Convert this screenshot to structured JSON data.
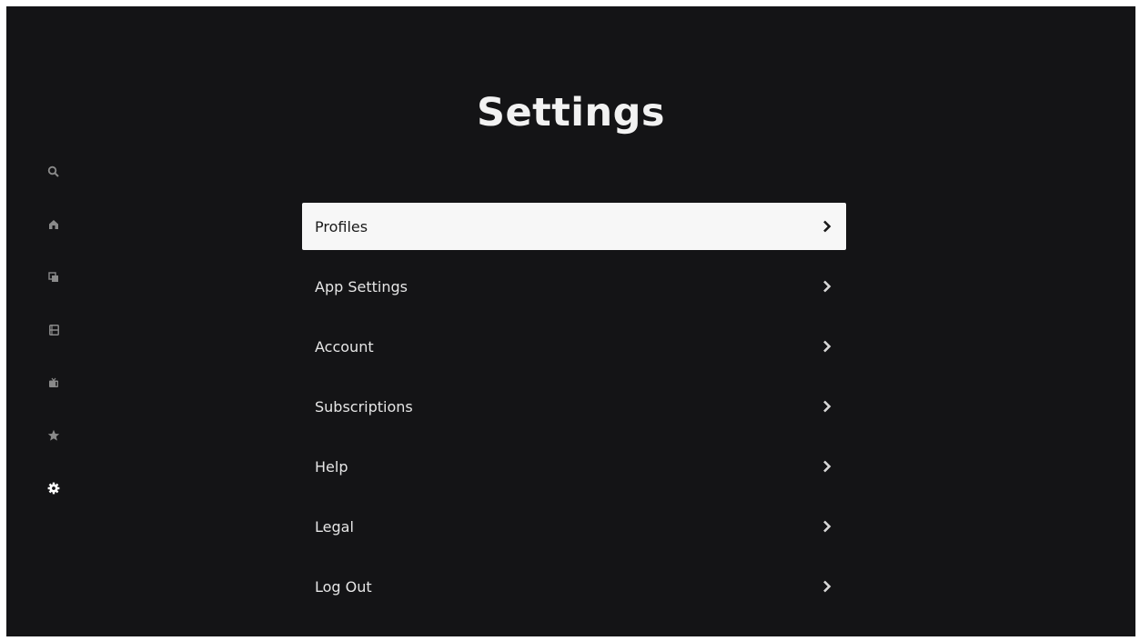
{
  "page": {
    "title": "Settings",
    "background": "#141416",
    "accent_selected": "#f7f7f7"
  },
  "sidebar": {
    "items": [
      {
        "icon": "search-icon",
        "active": false
      },
      {
        "icon": "home-icon",
        "active": false
      },
      {
        "icon": "copy-icon",
        "active": false
      },
      {
        "icon": "film-icon",
        "active": false
      },
      {
        "icon": "tv-icon",
        "active": false
      },
      {
        "icon": "star-icon",
        "active": false
      },
      {
        "icon": "gear-icon",
        "active": true
      }
    ]
  },
  "menu": {
    "items": [
      {
        "label": "Profiles",
        "selected": true,
        "icon": "chevron-right-icon"
      },
      {
        "label": "App Settings",
        "selected": false,
        "icon": "chevron-right-icon"
      },
      {
        "label": "Account",
        "selected": false,
        "icon": "chevron-right-icon"
      },
      {
        "label": "Subscriptions",
        "selected": false,
        "icon": "chevron-right-icon"
      },
      {
        "label": "Help",
        "selected": false,
        "icon": "chevron-right-icon"
      },
      {
        "label": "Legal",
        "selected": false,
        "icon": "chevron-right-icon"
      },
      {
        "label": "Log Out",
        "selected": false,
        "icon": "chevron-right-icon"
      }
    ]
  }
}
